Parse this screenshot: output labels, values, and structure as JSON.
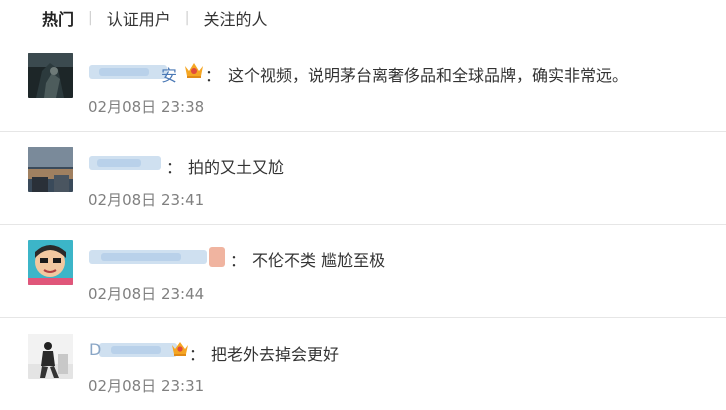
{
  "tabs": [
    {
      "label": "热门",
      "active": true
    },
    {
      "label": "认证用户",
      "active": false
    },
    {
      "label": "关注的人",
      "active": false
    }
  ],
  "comments": [
    {
      "username_visible": "安",
      "has_crown_badge": true,
      "colon": "：",
      "text": "这个视频，说明茅台离奢侈品和全球品牌，确实非常远。",
      "time": "02月08日 23:38"
    },
    {
      "username_visible": "",
      "has_crown_badge": false,
      "colon": "：",
      "text": "拍的又土又尬",
      "time": "02月08日 23:41"
    },
    {
      "username_visible": "",
      "has_crown_badge": false,
      "colon": "：",
      "text": "不伦不类 尴尬至极",
      "time": "02月08日 23:44"
    },
    {
      "username_visible": "D",
      "has_crown_badge": true,
      "colon": "：",
      "text": "把老外去掉会更好",
      "time": "02月08日 23:31"
    }
  ],
  "colors": {
    "text": "#333333",
    "time": "#808080",
    "divider": "#e6e6e6",
    "blur_name": "#c8dbee",
    "crown": "#f5a623"
  }
}
